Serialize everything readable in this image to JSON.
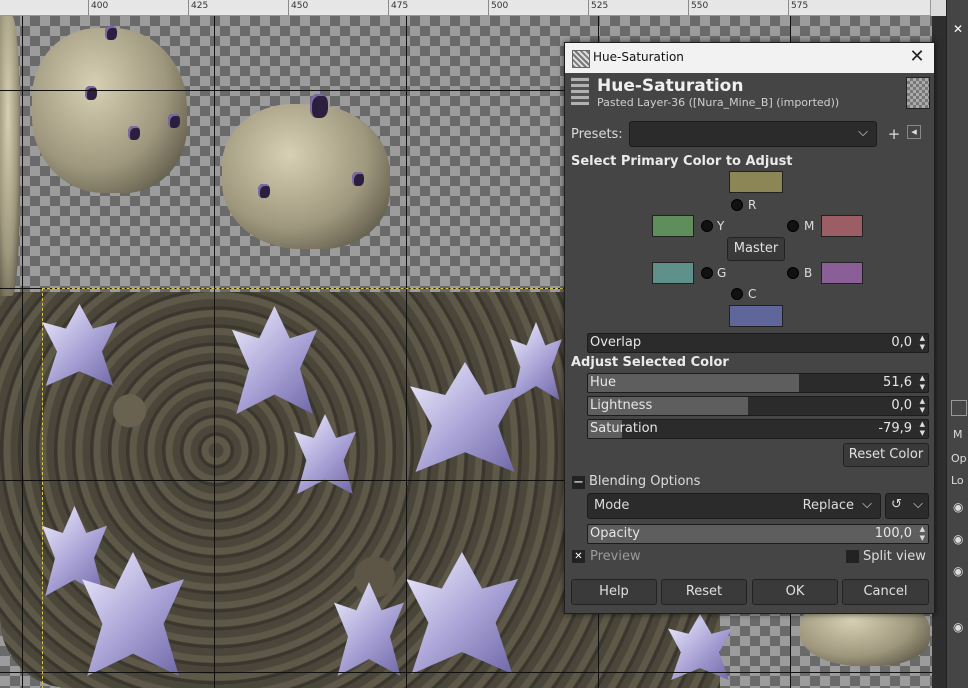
{
  "ruler": {
    "labels": [
      "400",
      "425",
      "450",
      "475",
      "500",
      "525",
      "550",
      "575"
    ]
  },
  "dialog": {
    "window_title": "Hue-Saturation",
    "close_glyph": "✕",
    "header_title": "Hue-Saturation",
    "header_subtitle": "Pasted Layer-36 ([Nura_Mine_B] (imported))",
    "presets_label": "Presets:",
    "presets_value": "",
    "add_glyph": "+",
    "menu_glyph": "◂",
    "section_primary": "Select Primary Color to Adjust",
    "colors": {
      "R": {
        "label": "R",
        "hex": "#8c8556"
      },
      "Y": {
        "label": "Y",
        "hex": "#5e8f5b"
      },
      "M": {
        "label": "M",
        "hex": "#9b5e65"
      },
      "G": {
        "label": "G",
        "hex": "#5d918a"
      },
      "B": {
        "label": "B",
        "hex": "#8a5e96"
      },
      "C": {
        "label": "C",
        "hex": "#5f6699"
      }
    },
    "master_label": "Master",
    "overlap": {
      "label": "Overlap",
      "value": "0,0",
      "fill": 0
    },
    "section_adjust": "Adjust Selected Color",
    "hue": {
      "label": "Hue",
      "value": "51,6",
      "fill": 0.62
    },
    "lightness": {
      "label": "Lightness",
      "value": "0,0",
      "fill": 0.47
    },
    "saturation": {
      "label": "Saturation",
      "value": "-79,9",
      "fill": 0.1
    },
    "reset_color_label": "Reset Color",
    "blending_toggle": "−",
    "blending_label": "Blending Options",
    "mode_label": "Mode",
    "mode_value": "Replace",
    "opacity": {
      "label": "Opacity",
      "value": "100,0",
      "fill": 1.0
    },
    "preview_label": "Preview",
    "preview_checked": "✕",
    "split_label": "Split view",
    "buttons": {
      "help": "Help",
      "reset": "Reset",
      "ok": "OK",
      "cancel": "Cancel"
    }
  },
  "side_panel": {
    "close_glyph": "✕",
    "tab_m": "M",
    "tab_op": "Op",
    "tab_lo": "Lo"
  }
}
